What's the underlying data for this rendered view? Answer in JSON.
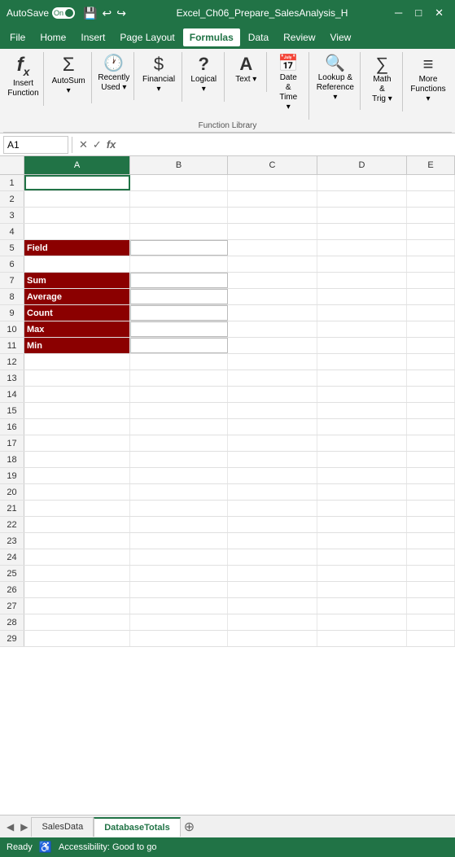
{
  "titleBar": {
    "autosave": "AutoSave",
    "on": "On",
    "title": "Excel_Ch06_Prepare_SalesAnalysis_H",
    "saveIcon": "💾",
    "undoIcon": "↩",
    "redoIcon": "↪"
  },
  "menuBar": {
    "items": [
      "File",
      "Home",
      "Insert",
      "Page Layout",
      "Formulas",
      "Data",
      "Review",
      "View"
    ],
    "active": "Formulas"
  },
  "ribbon": {
    "groups": [
      {
        "id": "insert-function",
        "label": "Insert Function",
        "icon": "fx",
        "buttons": []
      },
      {
        "id": "autosum",
        "label": "AutoSum",
        "icon": "Σ",
        "hasDropdown": true,
        "buttons": []
      },
      {
        "id": "recently-used",
        "label": "Recently Used",
        "icon": "🕐",
        "hasDropdown": true,
        "buttons": []
      },
      {
        "id": "financial",
        "label": "Financial",
        "icon": "$",
        "hasDropdown": true,
        "buttons": []
      },
      {
        "id": "logical",
        "label": "Logical",
        "icon": "?",
        "hasDropdown": true,
        "buttons": []
      },
      {
        "id": "text",
        "label": "Text",
        "icon": "A",
        "hasDropdown": true,
        "buttons": []
      },
      {
        "id": "date-time",
        "label": "Date & Time",
        "icon": "📅",
        "hasDropdown": true,
        "buttons": []
      },
      {
        "id": "lookup-reference",
        "label": "Lookup & Reference",
        "icon": "🔍",
        "hasDropdown": true,
        "buttons": []
      },
      {
        "id": "math-trig",
        "label": "Math & Trig",
        "icon": "∑",
        "hasDropdown": true,
        "buttons": []
      },
      {
        "id": "more-functions",
        "label": "More Functions",
        "icon": "≡",
        "hasDropdown": true,
        "buttons": []
      }
    ],
    "groupLabel": "Function Library"
  },
  "formulaBar": {
    "nameBox": "A1",
    "cancelIcon": "✕",
    "confirmIcon": "✓",
    "fxIcon": "fx",
    "formula": ""
  },
  "columns": [
    "A",
    "B",
    "C",
    "D",
    "E"
  ],
  "rows": [
    {
      "num": 1,
      "cells": [
        "",
        "",
        "",
        "",
        ""
      ]
    },
    {
      "num": 2,
      "cells": [
        "",
        "",
        "",
        "",
        ""
      ]
    },
    {
      "num": 3,
      "cells": [
        "",
        "",
        "",
        "",
        ""
      ]
    },
    {
      "num": 4,
      "cells": [
        "",
        "",
        "",
        "",
        ""
      ]
    },
    {
      "num": 5,
      "cells": [
        "Field",
        "",
        "",
        "",
        ""
      ],
      "a_style": "dark-red",
      "b_style": "white-box"
    },
    {
      "num": 6,
      "cells": [
        "",
        "",
        "",
        "",
        ""
      ]
    },
    {
      "num": 7,
      "cells": [
        "Sum",
        "",
        "",
        "",
        ""
      ],
      "a_style": "dark-red",
      "b_style": "white-box"
    },
    {
      "num": 8,
      "cells": [
        "Average",
        "",
        "",
        "",
        ""
      ],
      "a_style": "dark-red",
      "b_style": "white-box"
    },
    {
      "num": 9,
      "cells": [
        "Count",
        "",
        "",
        "",
        ""
      ],
      "a_style": "dark-red",
      "b_style": "white-box"
    },
    {
      "num": 10,
      "cells": [
        "Max",
        "",
        "",
        "",
        ""
      ],
      "a_style": "dark-red",
      "b_style": "white-box"
    },
    {
      "num": 11,
      "cells": [
        "Min",
        "",
        "",
        "",
        ""
      ],
      "a_style": "dark-red",
      "b_style": "white-box"
    },
    {
      "num": 12,
      "cells": [
        "",
        "",
        "",
        "",
        ""
      ]
    },
    {
      "num": 13,
      "cells": [
        "",
        "",
        "",
        "",
        ""
      ]
    },
    {
      "num": 14,
      "cells": [
        "",
        "",
        "",
        "",
        ""
      ]
    },
    {
      "num": 15,
      "cells": [
        "",
        "",
        "",
        "",
        ""
      ]
    },
    {
      "num": 16,
      "cells": [
        "",
        "",
        "",
        "",
        ""
      ]
    },
    {
      "num": 17,
      "cells": [
        "",
        "",
        "",
        "",
        ""
      ]
    },
    {
      "num": 18,
      "cells": [
        "",
        "",
        "",
        "",
        ""
      ]
    },
    {
      "num": 19,
      "cells": [
        "",
        "",
        "",
        "",
        ""
      ]
    },
    {
      "num": 20,
      "cells": [
        "",
        "",
        "",
        "",
        ""
      ]
    },
    {
      "num": 21,
      "cells": [
        "",
        "",
        "",
        "",
        ""
      ]
    },
    {
      "num": 22,
      "cells": [
        "",
        "",
        "",
        "",
        ""
      ]
    },
    {
      "num": 23,
      "cells": [
        "",
        "",
        "",
        "",
        ""
      ]
    },
    {
      "num": 24,
      "cells": [
        "",
        "",
        "",
        "",
        ""
      ]
    },
    {
      "num": 25,
      "cells": [
        "",
        "",
        "",
        "",
        ""
      ]
    },
    {
      "num": 26,
      "cells": [
        "",
        "",
        "",
        "",
        ""
      ]
    },
    {
      "num": 27,
      "cells": [
        "",
        "",
        "",
        "",
        ""
      ]
    },
    {
      "num": 28,
      "cells": [
        "",
        "",
        "",
        "",
        ""
      ]
    },
    {
      "num": 29,
      "cells": [
        "",
        "",
        "",
        "",
        ""
      ]
    }
  ],
  "tabs": [
    {
      "label": "SalesData",
      "active": false
    },
    {
      "label": "DatabaseTotals",
      "active": true
    }
  ],
  "statusBar": {
    "ready": "Ready",
    "accessibility": "Accessibility: Good to go"
  }
}
